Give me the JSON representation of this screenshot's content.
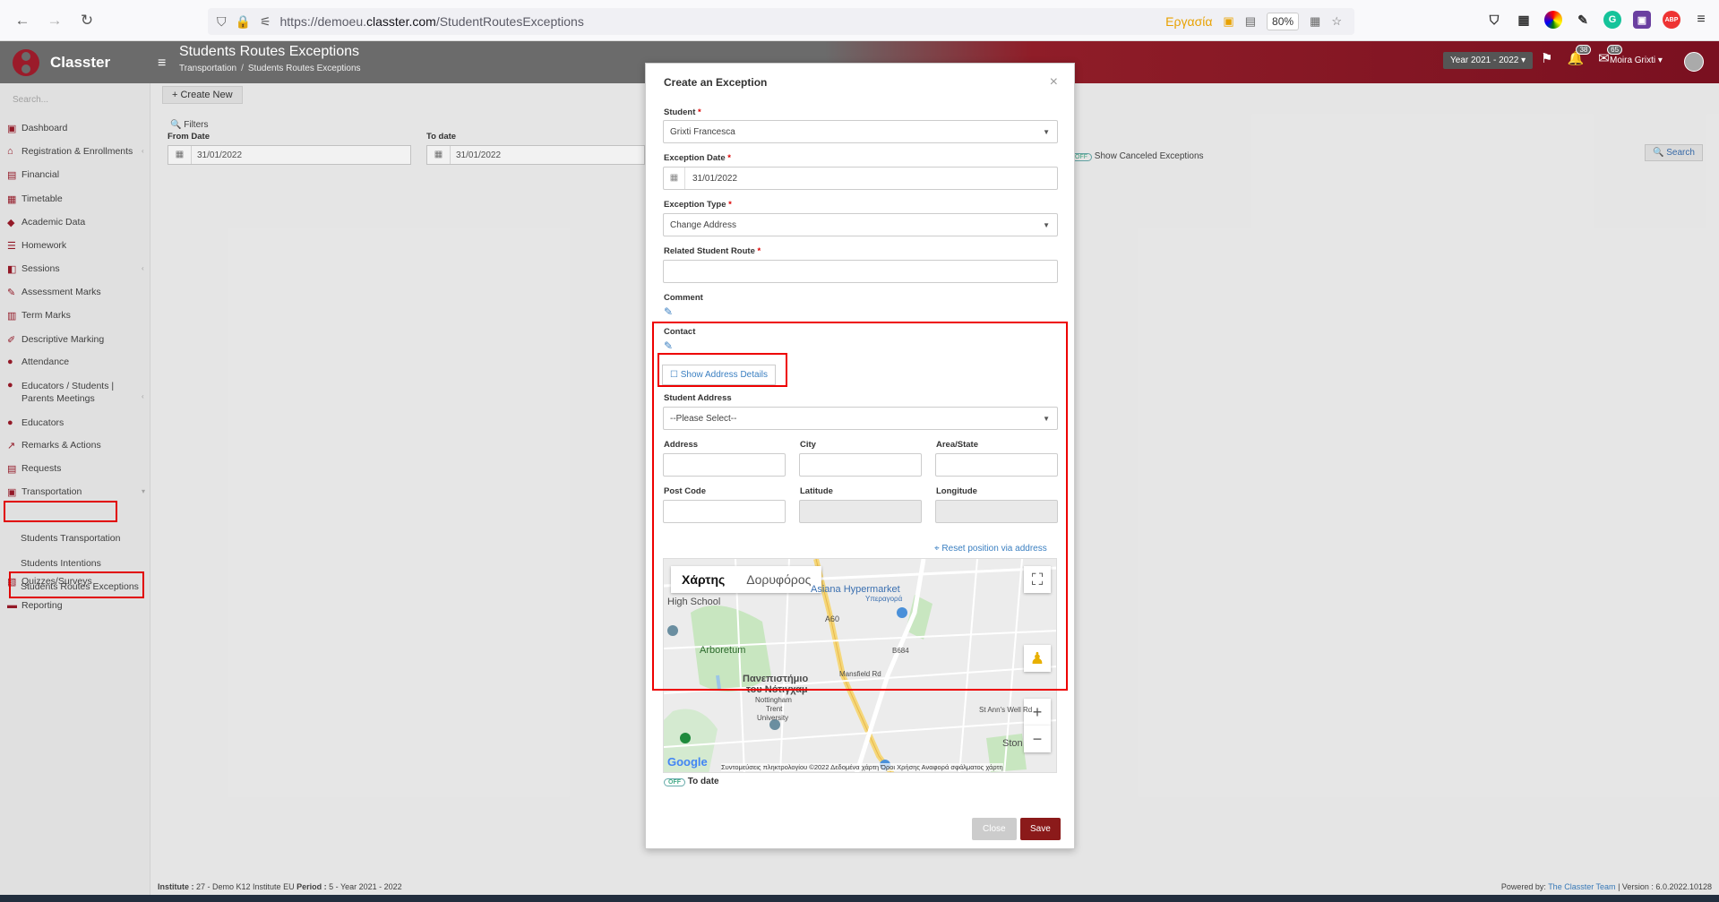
{
  "browser": {
    "url_prefix": "https://demoeu.",
    "url_domain": "classter.com",
    "url_path": "/StudentRoutesExceptions",
    "container_label": "Εργασία",
    "zoom": "80%"
  },
  "app": {
    "logo": "Classter",
    "page_title": "Students Routes Exceptions",
    "breadcrumb": [
      "Transportation",
      "Students Routes Exceptions"
    ],
    "year": "Year 2021 - 2022",
    "badge_notifications": "38",
    "badge_messages": "65",
    "user": "Moira Grixti"
  },
  "sidebar": {
    "search_placeholder": "Search...",
    "items": [
      {
        "label": "Dashboard",
        "icon": "dashboard-icon"
      },
      {
        "label": "Registration & Enrollments",
        "icon": "institution-icon"
      },
      {
        "label": "Financial",
        "icon": "money-icon"
      },
      {
        "label": "Timetable",
        "icon": "calendar-icon"
      },
      {
        "label": "Academic Data",
        "icon": "graduation-icon"
      },
      {
        "label": "Homework",
        "icon": "list-icon"
      },
      {
        "label": "Sessions",
        "icon": "sessions-icon"
      },
      {
        "label": "Assessment Marks",
        "icon": "edit-icon"
      },
      {
        "label": "Term Marks",
        "icon": "book-icon"
      },
      {
        "label": "Descriptive Marking",
        "icon": "pencil-icon"
      },
      {
        "label": "Attendance",
        "icon": "user-icon"
      },
      {
        "label": "Educators / Students | Parents Meetings",
        "icon": "meeting-icon"
      },
      {
        "label": "Educators",
        "icon": "users-icon"
      },
      {
        "label": "Remarks & Actions",
        "icon": "remarks-icon"
      },
      {
        "label": "Requests",
        "icon": "request-icon"
      },
      {
        "label": "Transportation",
        "icon": "bus-icon"
      },
      {
        "label": "Quizzes/Surveys",
        "icon": "quiz-icon"
      },
      {
        "label": "Reporting",
        "icon": "print-icon"
      }
    ],
    "sub_items": [
      "Students Transportation",
      "Students Intentions",
      "Students Routes Exceptions"
    ]
  },
  "main": {
    "create_new": "Create New",
    "filters": "Filters",
    "from_date_label": "From Date",
    "from_date": "31/01/2022",
    "to_date_label": "To date",
    "to_date": "31/01/2022",
    "toggle_off": "OFF",
    "show_canceled": "Show Canceled Exceptions",
    "search": "Search"
  },
  "modal": {
    "title": "Create an Exception",
    "student_label": "Student",
    "student_value": "Grixti Francesca",
    "exception_date_label": "Exception Date",
    "exception_date": "31/01/2022",
    "exception_type_label": "Exception Type",
    "exception_type": "Change Address",
    "related_route_label": "Related Student Route",
    "comment_label": "Comment",
    "contact_label": "Contact",
    "show_address_details": "Show Address Details",
    "student_address_label": "Student Address",
    "student_address_value": "--Please Select--",
    "address_label": "Address",
    "city_label": "City",
    "area_label": "Area/State",
    "postcode_label": "Post Code",
    "latitude_label": "Latitude",
    "longitude_label": "Longitude",
    "reset_position": "Reset position via address",
    "map": {
      "tab_map": "Χάρτης",
      "tab_satellite": "Δορυφόρος",
      "labels": [
        "Asiana Hypermarket",
        "Υπεραγορά",
        "High School",
        "Arboretum",
        "Πανεπιστήμιο",
        "του Νότιγχαμ",
        "Nottingham",
        "Trent",
        "University",
        "A60",
        "B684",
        "Mansfield Rd",
        "St Ann's Well Rd",
        "Ston"
      ],
      "credit": "Συντομεύσεις πληκτρολογίου   ©2022 Δεδομένα χάρτη   Όροι Χρήσης   Αναφορά σφάλματος χάρτη"
    },
    "todate_toggle": "OFF",
    "todate_label": "To date",
    "close_btn": "Close",
    "save_btn": "Save"
  },
  "footer": {
    "institute_label": "Institute :",
    "institute": "27 - Demo K12 Institute EU",
    "period_label": "Period :",
    "period": "5 - Year 2021 - 2022",
    "powered": "Powered by:",
    "team": "The Classter Team",
    "version": "| Version : 6.0.2022.10128"
  }
}
